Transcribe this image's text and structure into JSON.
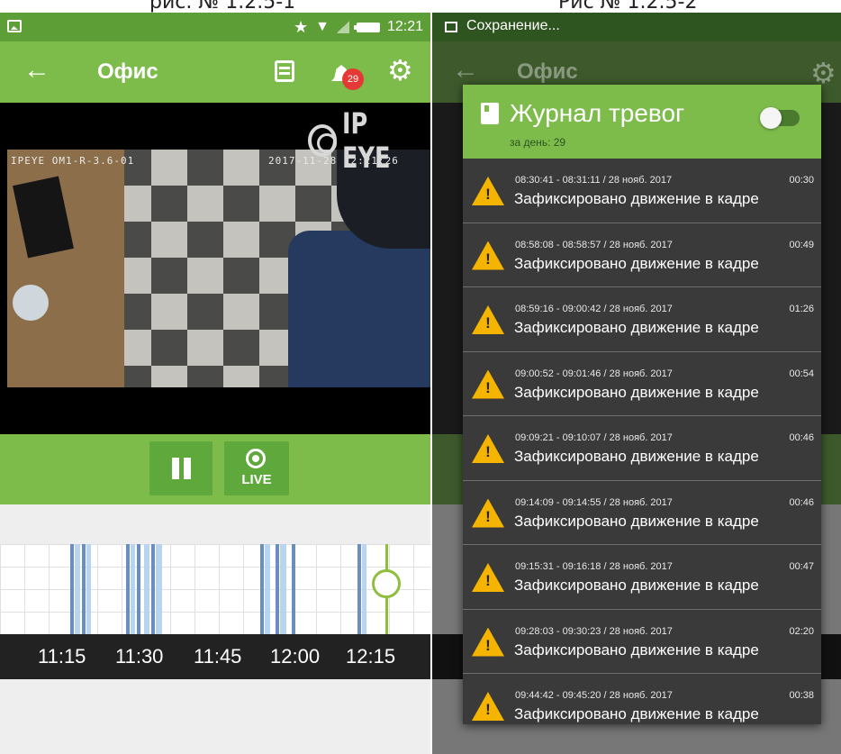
{
  "captions": {
    "left": "рис. № 1.2.5-1",
    "right": "Рис № 1.2.5-2"
  },
  "left_screen": {
    "status_bar": {
      "time": "12:21",
      "icons": [
        "gallery-icon",
        "star-icon",
        "wifi-icon",
        "signal-icon",
        "battery-icon"
      ]
    },
    "app_bar": {
      "title": "Офис",
      "back_icon": "arrow-back-icon",
      "calendar_icon": "calendar-icon",
      "alarm_icon": "alarm-bell-icon",
      "alarm_badge": "29",
      "settings_icon": "gear-icon"
    },
    "video": {
      "osd_left": "IPEYE OM1-R-3.6-01",
      "osd_right": "2017-11-28 12:21:26",
      "watermark": "IP EYE"
    },
    "controls": {
      "pause_icon": "pause-icon",
      "live_label": "LIVE"
    },
    "timeline": {
      "ticks": [
        "11:15",
        "11:30",
        "11:45",
        "12:00",
        "12:15"
      ],
      "colors": {
        "dark_bar": "#6a8fbe",
        "light_bar": "#b9d4ef",
        "cursor": "#8fbe3e"
      }
    }
  },
  "right_screen": {
    "status_bar": {
      "text": "Сохранение..."
    },
    "app_bar": {
      "title": "Офис"
    },
    "journal": {
      "title": "Журнал тревог",
      "count_label": "за день: 29",
      "toggle_state": "on",
      "items": [
        {
          "time": "08:30:41 - 08:31:11 / 28 нояб. 2017",
          "duration": "00:30",
          "text": "Зафиксировано движение в кадре"
        },
        {
          "time": "08:58:08 - 08:58:57 / 28 нояб. 2017",
          "duration": "00:49",
          "text": "Зафиксировано движение в кадре"
        },
        {
          "time": "08:59:16 - 09:00:42 / 28 нояб. 2017",
          "duration": "01:26",
          "text": "Зафиксировано движение в кадре"
        },
        {
          "time": "09:00:52 - 09:01:46 / 28 нояб. 2017",
          "duration": "00:54",
          "text": "Зафиксировано движение в кадре"
        },
        {
          "time": "09:09:21 - 09:10:07 / 28 нояб. 2017",
          "duration": "00:46",
          "text": "Зафиксировано движение в кадре"
        },
        {
          "time": "09:14:09 - 09:14:55 / 28 нояб. 2017",
          "duration": "00:46",
          "text": "Зафиксировано движение в кадре"
        },
        {
          "time": "09:15:31 - 09:16:18 / 28 нояб. 2017",
          "duration": "00:47",
          "text": "Зафиксировано движение в кадре"
        },
        {
          "time": "09:28:03 - 09:30:23 / 28 нояб. 2017",
          "duration": "02:20",
          "text": "Зафиксировано движение в кадре"
        },
        {
          "time": "09:44:42 - 09:45:20 / 28 нояб. 2017",
          "duration": "00:38",
          "text": "Зафиксировано движение в кадре"
        }
      ]
    }
  },
  "colors": {
    "primary_green": "#7dbb4b",
    "status_green": "#5e9e36",
    "badge_red": "#e53935",
    "warning_yellow": "#f4b400"
  }
}
